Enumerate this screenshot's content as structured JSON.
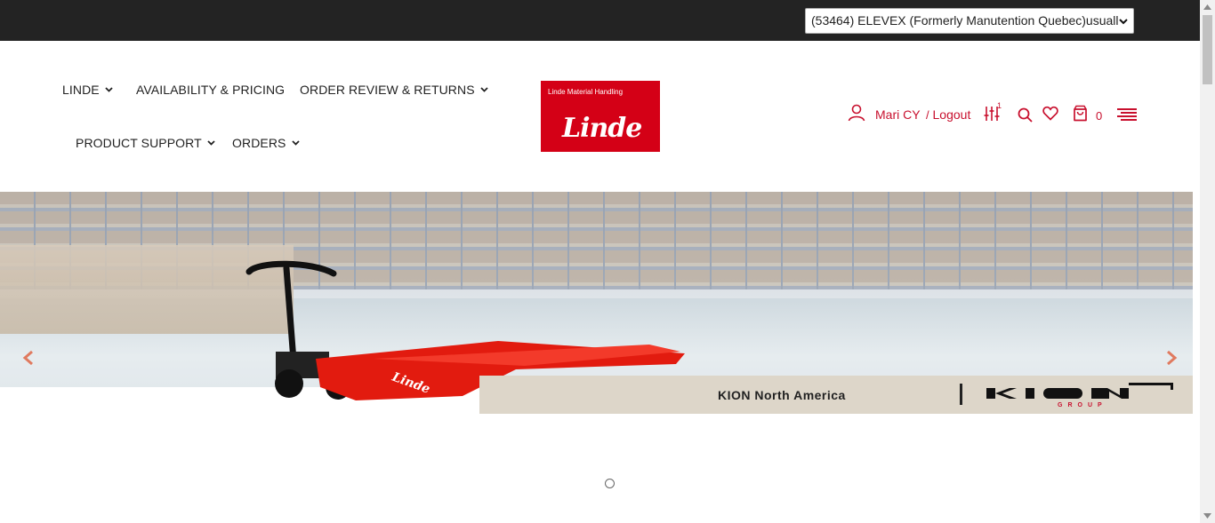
{
  "topbar": {
    "account_selected": "(53464) ELEVEX (Formerly Manutention Quebec)usuall"
  },
  "nav": {
    "items": [
      {
        "label": "LINDE",
        "has_dropdown": true
      },
      {
        "label": "AVAILABILITY & PRICING",
        "has_dropdown": false
      },
      {
        "label": "ORDER REVIEW & RETURNS",
        "has_dropdown": true
      },
      {
        "label": "PRODUCT SUPPORT",
        "has_dropdown": true
      },
      {
        "label": "ORDERS",
        "has_dropdown": true
      }
    ]
  },
  "logo": {
    "tagline": "Linde Material Handling",
    "wordmark": "Linde",
    "color": "#d40016"
  },
  "user": {
    "name": "Mari CY",
    "logout_label": "Logout",
    "separator": "/",
    "compare_count": "1",
    "cart_count": "0",
    "accent_color": "#c8102e"
  },
  "icons": {
    "user": "user-icon",
    "compare": "sliders-icon",
    "search": "search-icon",
    "wishlist": "heart-icon",
    "cart": "shopping-bag-icon",
    "menu": "hamburger-menu-icon",
    "prev": "chevron-left-icon",
    "next": "chevron-right-icon"
  },
  "hero": {
    "banner_text": "KION North America",
    "brand_logo": "KION GROUP",
    "slide_count": 1,
    "active_slide": 1
  }
}
